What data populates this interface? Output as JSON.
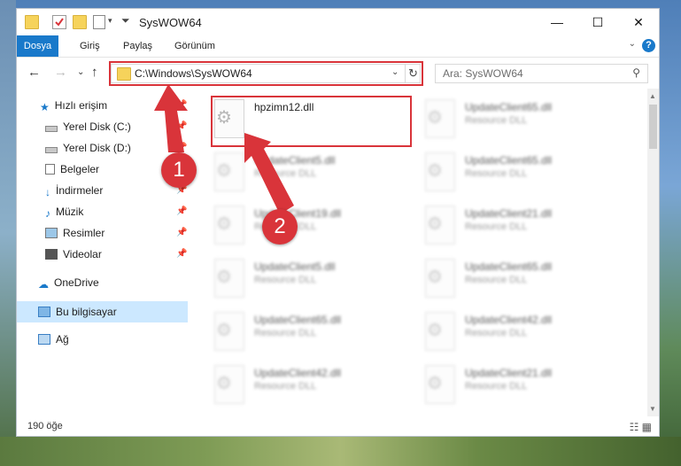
{
  "window": {
    "title": "SysWOW64"
  },
  "ribbon": {
    "tabs": [
      "Dosya",
      "Giriş",
      "Paylaş",
      "Görünüm"
    ],
    "help": "?"
  },
  "address": {
    "path": "C:\\Windows\\SysWOW64",
    "refresh": "↻",
    "dropdown": "⌄"
  },
  "search": {
    "placeholder": "Ara: SysWOW64"
  },
  "sidebar": {
    "items": [
      {
        "label": "Hızlı erişim",
        "icon": "star-icon"
      },
      {
        "label": "Yerel Disk (C:)",
        "icon": "drive-icon"
      },
      {
        "label": "Yerel Disk (D:)",
        "icon": "drive-icon"
      },
      {
        "label": "Belgeler",
        "icon": "document-icon"
      },
      {
        "label": "İndirmeler",
        "icon": "download-icon"
      },
      {
        "label": "Müzik",
        "icon": "music-icon"
      },
      {
        "label": "Resimler",
        "icon": "pictures-icon"
      },
      {
        "label": "Videolar",
        "icon": "video-icon"
      },
      {
        "label": "OneDrive",
        "icon": "cloud-icon"
      },
      {
        "label": "Bu bilgisayar",
        "icon": "computer-icon"
      },
      {
        "label": "Ağ",
        "icon": "network-icon"
      }
    ]
  },
  "files": {
    "highlighted": {
      "name": "hpzimn12.dll",
      "type": ""
    },
    "left_column": [
      {
        "name": "UpdateClient5.dll",
        "type": "Resource DLL"
      },
      {
        "name": "UpdateClient19.dll",
        "type": "Resource DLL"
      },
      {
        "name": "UpdateClient5.dll",
        "type": "Resource DLL"
      },
      {
        "name": "UpdateClient65.dll",
        "type": "Resource DLL"
      },
      {
        "name": "UpdateClient42.dll",
        "type": "Resource DLL"
      }
    ],
    "right_column": [
      {
        "name": "UpdateClient65.dll",
        "type": "Resource DLL"
      },
      {
        "name": "UpdateClient65.dll",
        "type": "Resource DLL"
      },
      {
        "name": "UpdateClient21.dll",
        "type": "Resource DLL"
      },
      {
        "name": "UpdateClient65.dll",
        "type": "Resource DLL"
      },
      {
        "name": "UpdateClient42.dll",
        "type": "Resource DLL"
      },
      {
        "name": "UpdateClient21.dll",
        "type": "Resource DLL"
      }
    ]
  },
  "status": {
    "count": "190 öğe"
  },
  "callouts": {
    "one": "1",
    "two": "2"
  },
  "colors": {
    "highlight": "#d9343a",
    "accent": "#1979ca",
    "selected": "#cce8ff"
  }
}
